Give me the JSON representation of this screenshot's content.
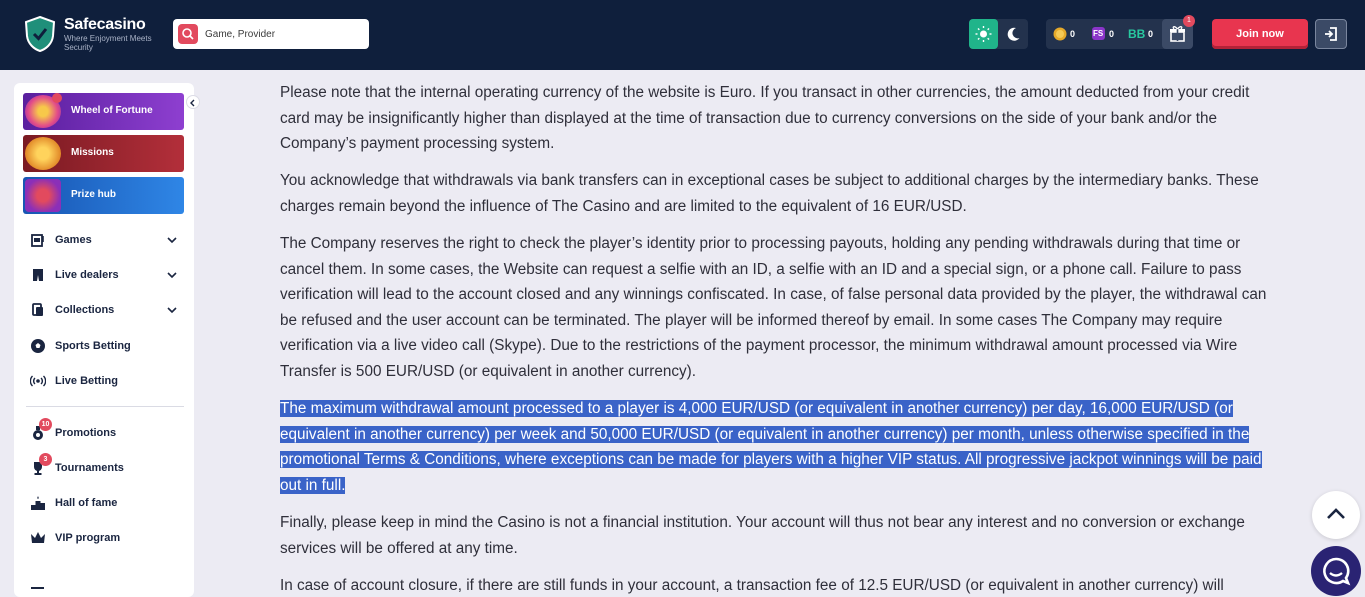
{
  "header": {
    "logo_name": "Safecasino",
    "logo_tagline": "Where Enjoyment Meets Security",
    "search_placeholder": "Game, Provider",
    "wallet": {
      "coins": "0",
      "free_spins": "0",
      "free_spins_label": "FS",
      "bonus_balance": "0",
      "bonus_label": "BB"
    },
    "gift_badge": "1",
    "join_label": "Join now"
  },
  "sidebar": {
    "promos": [
      {
        "label": "Wheel of Fortune",
        "color": "#7a2fb8"
      },
      {
        "label": "Missions",
        "color": "#a6242e"
      },
      {
        "label": "Prize hub",
        "color": "#1e6fd0"
      }
    ],
    "nav": [
      {
        "label": "Games"
      },
      {
        "label": "Live dealers"
      },
      {
        "label": "Collections"
      },
      {
        "label": "Sports Betting"
      },
      {
        "label": "Live Betting"
      },
      {
        "label": "Promotions",
        "badge": "10"
      },
      {
        "label": "Tournaments",
        "badge": "3"
      },
      {
        "label": "Hall of fame"
      },
      {
        "label": "VIP program"
      }
    ]
  },
  "content": {
    "paragraphs": [
      "Please note that the internal operating currency of the website is Euro. If you transact in other currencies, the amount deducted from your credit card may be insignificantly higher than displayed at the time of transaction due to currency conversions on the side of your bank and/or the Company’s payment processing system.",
      "You acknowledge that withdrawals via bank transfers can in exceptional cases be subject to additional charges by the intermediary banks. These charges remain beyond the influence of The Casino and are limited to the equivalent of 16 EUR/USD.",
      "The Company reserves the right to check the player’s identity prior to processing payouts, holding any pending withdrawals during that time or cancel them. In some cases, the Website can request a selfie with an ID, a selfie with an ID and a special sign, or a phone call. Failure to pass verification will lead to the account closed and any winnings confiscated. In case, of false personal data provided by the player, the withdrawal can be refused and the user account can be terminated. The player will be informed thereof by email. In some cases The Company may require verification via a live video call (Skype). Due to the restrictions of the payment processor, the minimum withdrawal amount processed via Wire Transfer is 500 EUR/USD (or equivalent in another currency).",
      "The maximum withdrawal amount processed to a player is 4,000 EUR/USD (or equivalent in another currency) per day, 16,000 EUR/USD (or equivalent in another currency) per week and 50,000 EUR/USD (or equivalent in another currency) per month, unless otherwise specified in the promotional Terms & Conditions, where exceptions can be made for players with a higher VIP status. All progressive jackpot winnings will be paid out in full.",
      "Finally, please keep in mind the Casino is not a financial institution. Your account will thus not bear any interest and no conversion or exchange services will be offered at any time.",
      "In case of account closure, if there are still funds in your account, a transaction fee of 12.5 EUR/USD (or equivalent in another currency) will"
    ]
  }
}
